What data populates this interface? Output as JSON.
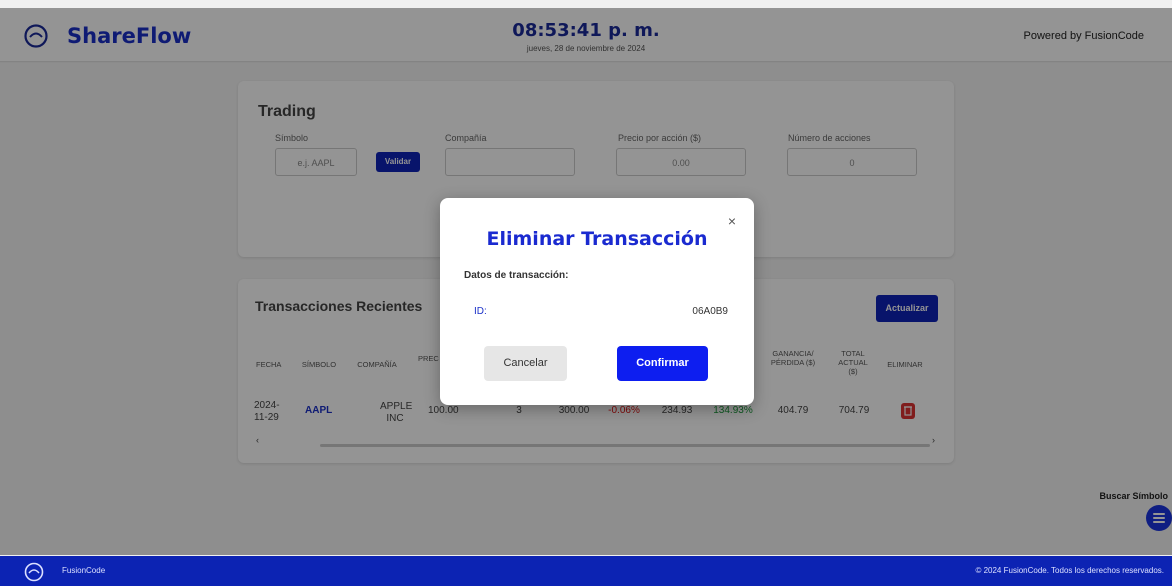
{
  "header": {
    "brand": "ShareFlow",
    "time": "08:53:41 p. m.",
    "date": "jueves, 28 de noviembre de 2024",
    "powered_by": "Powered by FusionCode"
  },
  "trading": {
    "title": "Trading",
    "symbol_label": "Símbolo",
    "symbol_placeholder": "e.j. AAPL",
    "validate_label": "Validar",
    "company_label": "Compañía",
    "company_value": "",
    "price_label": "Precio por acción ($)",
    "price_value": "0.00",
    "shares_label": "Número de acciones",
    "shares_value": "0"
  },
  "transactions": {
    "title": "Transacciones Recientes",
    "refresh_label": "Actualizar",
    "columns": [
      "FECHA",
      "SÍMBOLO",
      "COMPAÑÍA",
      "PREC",
      "GANANCIA/ PÉRDIDA ($)",
      "TOTAL ACTUAL ($)",
      "ELIMINAR"
    ],
    "rows": [
      {
        "date": "2024-11-29",
        "symbol": "AAPL",
        "company": "APPLE INC",
        "price": "100.00",
        "shares": "3",
        "total": "300.00",
        "change": "-0.06%",
        "current_price": "234.93",
        "pct": "134.93%",
        "gain": "404.79",
        "current_total": "704.79"
      }
    ]
  },
  "modal": {
    "title": "Eliminar Transacción",
    "subtitle": "Datos de transacción:",
    "id_label": "ID:",
    "id_value": "06A0B9",
    "cancel_label": "Cancelar",
    "confirm_label": "Confirmar",
    "close_glyph": "×"
  },
  "floating": {
    "search_label": "Buscar Símbolo"
  },
  "footer": {
    "brand": "FusionCode",
    "copyright": "© 2024 FusionCode. Todos los derechos reservados."
  },
  "colors": {
    "brand_blue": "#1a30c8",
    "primary_button": "#0f23b8",
    "footer_bg": "#0c23b3",
    "negative": "#dd1111",
    "positive": "#1a9a3a",
    "delete": "#dd3333"
  },
  "icons": [
    "logo-icon",
    "close-icon",
    "trash-icon",
    "menu-icon",
    "scroll-left-icon",
    "scroll-right-icon"
  ]
}
